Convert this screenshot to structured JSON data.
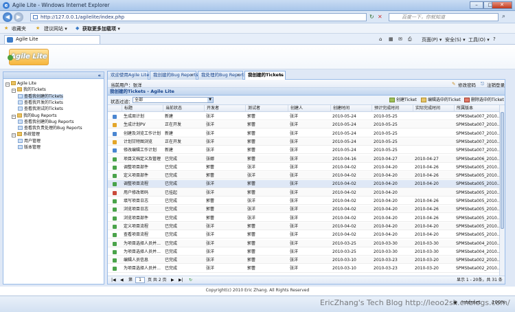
{
  "window": {
    "title": "Agile Lite - Windows Internet Explorer",
    "min": "–",
    "max": "□",
    "close": "✕"
  },
  "address": {
    "url": "http://127.0.0.1/agilelite/index.php",
    "search_placeholder": "百度一下，你就知道"
  },
  "favorites": {
    "fav": "收藏夹",
    "suggest": "建议网站 ▾",
    "addons": "获取更多加载项 ▾"
  },
  "ie_tab": {
    "label": "Agile Lite",
    "tools": [
      "页面(P) ▾",
      "安全(S) ▾",
      "工具(O) ▾",
      "?"
    ]
  },
  "logo": "Agile Lite",
  "sidebar": {
    "collapse": "«",
    "tree": [
      {
        "label": "Agile Lite",
        "level": 0,
        "type": "root"
      },
      {
        "label": "我的Tickets",
        "level": 1,
        "type": "folder"
      },
      {
        "label": "查看我创建的Tickets",
        "level": 2,
        "type": "leaf",
        "selected": true
      },
      {
        "label": "查看我开发的Tickets",
        "level": 2,
        "type": "leaf"
      },
      {
        "label": "查看我测试的Tickets",
        "level": 2,
        "type": "leaf"
      },
      {
        "label": "我的Bug Reports",
        "level": 1,
        "type": "folder"
      },
      {
        "label": "查看我创建的Bug Reports",
        "level": 2,
        "type": "leaf"
      },
      {
        "label": "查看我负责处理的Bug Reports",
        "level": 2,
        "type": "leaf"
      },
      {
        "label": "系统管理",
        "level": 1,
        "type": "folder"
      },
      {
        "label": "用户管理",
        "level": 2,
        "type": "leaf"
      },
      {
        "label": "版本管理",
        "level": 2,
        "type": "leaf"
      }
    ]
  },
  "tabs": [
    {
      "label": "欢迎使用Agile Lite",
      "active": false,
      "closable": false
    },
    {
      "label": "我创建的Bug Reports",
      "active": false,
      "closable": true
    },
    {
      "label": "我处理的Bug Reports",
      "active": false,
      "closable": true
    },
    {
      "label": "我创建的Tickets",
      "active": true,
      "closable": true
    }
  ],
  "userbar": {
    "current_user": "当前用户：张洋",
    "change_pwd": "修改密码",
    "logout": "注销登录"
  },
  "panel_title": "我创建的Tickets - Agile Lite",
  "filter": {
    "label": "状态过滤：",
    "value": "全部"
  },
  "toolbar": {
    "create": "创建Ticket",
    "edit": "编辑选中的Ticket",
    "delete": "删除选中的Ticket"
  },
  "grid": {
    "columns": [
      "标题",
      "当前状态",
      "开发者",
      "测试者",
      "创建人",
      "创建时间",
      "预计完成时间",
      "实际完成时间",
      "所属版本"
    ],
    "rows": [
      [
        "生成周计划",
        "新建",
        "张洋",
        "郭蕾",
        "张洋",
        "2010-05-24",
        "2010-05-25",
        "",
        "SPMSbeta007_2010..."
      ],
      [
        "生成计划PV",
        "正在开发",
        "张洋",
        "郭蕾",
        "张洋",
        "2010-05-24",
        "2010-05-25",
        "",
        "SPMSbeta007_2010..."
      ],
      [
        "创建及浏览工作计划",
        "新建",
        "张洋",
        "郭蕾",
        "张洋",
        "2010-05-24",
        "2010-05-25",
        "",
        "SPMSbeta007_2010..."
      ],
      [
        "计划甘特图浏览",
        "正在开发",
        "张洋",
        "郭蕾",
        "张洋",
        "2010-05-24",
        "2010-05-25",
        "",
        "SPMSbeta007_2010..."
      ],
      [
        "修改编辑工作计划",
        "新建",
        "张洋",
        "郭蕾",
        "张洋",
        "2010-05-24",
        "2010-05-25",
        "",
        "SPMSbeta007_2010..."
      ],
      [
        "项目文档定义及管理",
        "已完成",
        "张娜",
        "郭蕾",
        "张洋",
        "2010-04-16",
        "2010-04-27",
        "2010-04-27",
        "SPMSbeta006_2010..."
      ],
      [
        "调整项目部件",
        "已完成",
        "郭蕾",
        "张洋",
        "张洋",
        "2010-04-02",
        "2010-04-20",
        "2010-04-26",
        "SPMSbeta005_2010..."
      ],
      [
        "定义项目部件",
        "已完成",
        "郭蕾",
        "张洋",
        "张洋",
        "2010-04-02",
        "2010-04-20",
        "2010-04-26",
        "SPMSbeta005_2010..."
      ],
      [
        "调整项目流程",
        "已完成",
        "张洋",
        "郭蕾",
        "张洋",
        "2010-04-02",
        "2010-04-20",
        "2010-04-20",
        "SPMSbeta005_2010..."
      ],
      [
        "用户修改密码",
        "已挂起",
        "张洋",
        "郭蕾",
        "张洋",
        "2010-04-02",
        "2010-04-20",
        "",
        "SPMSbeta005_2010..."
      ],
      [
        "填写项目日志",
        "已完成",
        "郭蕾",
        "张洋",
        "张洋",
        "2010-04-02",
        "2010-04-20",
        "2010-04-26",
        "SPMSbeta005_2010..."
      ],
      [
        "浏览项目日志",
        "已完成",
        "郭蕾",
        "张洋",
        "张洋",
        "2010-04-02",
        "2010-04-20",
        "2010-04-26",
        "SPMSbeta005_2010..."
      ],
      [
        "浏览项目部件",
        "已完成",
        "郭蕾",
        "张洋",
        "张洋",
        "2010-04-02",
        "2010-04-20",
        "2010-04-26",
        "SPMSbeta005_2010..."
      ],
      [
        "定义项目流程",
        "已完成",
        "张洋",
        "郭蕾",
        "张洋",
        "2010-04-02",
        "2010-04-20",
        "2010-04-20",
        "SPMSbeta005_2010..."
      ],
      [
        "查看项目流程",
        "已完成",
        "张洋",
        "郭蕾",
        "张洋",
        "2010-04-02",
        "2010-04-20",
        "2010-04-20",
        "SPMSbeta005_2010..."
      ],
      [
        "为项目选择人员并…",
        "已完成",
        "张洋",
        "郭蕾",
        "张洋",
        "2010-03-25",
        "2010-03-30",
        "2010-03-30",
        "SPMSbeta004_2010..."
      ],
      [
        "为项目选择人员并…",
        "已完成",
        "张洋",
        "郭蕾",
        "张洋",
        "2010-03-25",
        "2010-03-30",
        "2010-03-30",
        "SPMSbeta004_2010..."
      ],
      [
        "编辑人员信息",
        "已完成",
        "张洋",
        "郭蕾",
        "张洋",
        "2010-03-10",
        "2010-03-23",
        "2010-03-20",
        "SPMSbeta002_2010..."
      ],
      [
        "为项目选择人员并…",
        "已完成",
        "张洋",
        "郭蕾",
        "张洋",
        "2010-03-10",
        "2010-03-23",
        "2010-03-20",
        "SPMSbeta002_2010..."
      ]
    ],
    "highlight_row": 8
  },
  "pager": {
    "first": "|◀",
    "prev": "◀",
    "page_label": "第",
    "page": "1",
    "of": "页 共 2 页",
    "next": "▶",
    "last": "▶|",
    "refresh": "↻",
    "summary": "显示 1 - 20条，共 31 条"
  },
  "footer": "Copyright(c) 2010 Eric Zhang. All Rights Reserved",
  "statusbar": {
    "watermark": "EricZhang's Tech Blog http://leoo2sk.cnblogs.com/",
    "zone": "Internet",
    "zoom": "100%"
  },
  "colors": {
    "accent": "#15428b",
    "panel_border": "#99bbe8",
    "logo_orange": "#f6b63d"
  }
}
